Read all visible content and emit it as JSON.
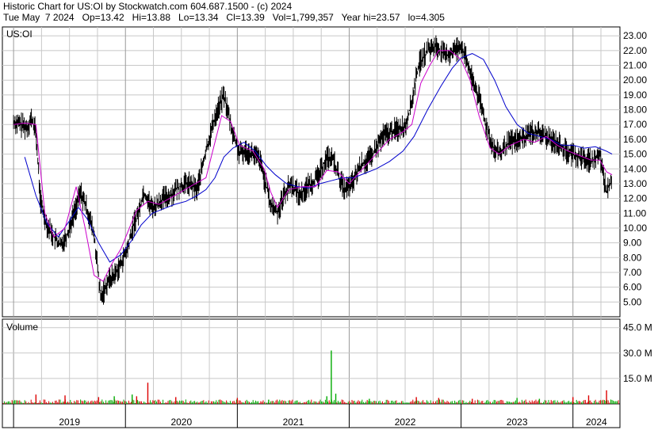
{
  "header": {
    "line1": "Historic Chart for US:OI by Stockwatch.com 604.687.1500 - (c) 2024",
    "line2": "Tue May  7 2024   Op=13.42   Hi=13.88   Lo=13.34   Cl=13.39   Vol=1,799,357   Year hi=23.57   lo=4.305"
  },
  "colors": {
    "price": "#000000",
    "ma_short": "#cc00cc",
    "ma_long": "#0000cc",
    "volume_up": "#00aa00",
    "volume_down": "#dd0000",
    "grid": "#c8c8c8"
  },
  "chart_data": {
    "type": "line",
    "symbol_label": "US:OI",
    "price_panel": {
      "ylim": [
        4.0,
        23.6
      ],
      "yticks": [
        5,
        6,
        7,
        8,
        9,
        10,
        11,
        12,
        13,
        14,
        15,
        16,
        17,
        18,
        19,
        20,
        21,
        22,
        23
      ],
      "ytick_labels": [
        "5.00",
        "6.00",
        "7.00",
        "8.00",
        "9.00",
        "10.00",
        "11.00",
        "12.00",
        "13.00",
        "14.00",
        "15.00",
        "16.00",
        "17.00",
        "18.00",
        "19.00",
        "20.00",
        "21.00",
        "22.00",
        "23.00"
      ],
      "close_series": {
        "t": [
          2019.0,
          2019.06,
          2019.12,
          2019.16,
          2019.2,
          2019.24,
          2019.3,
          2019.36,
          2019.42,
          2019.48,
          2019.54,
          2019.6,
          2019.66,
          2019.72,
          2019.78,
          2019.84,
          2019.9,
          2019.96,
          2020.02,
          2020.08,
          2020.12,
          2020.16,
          2020.2,
          2020.22,
          2020.26,
          2020.32,
          2020.4,
          2020.48,
          2020.56,
          2020.64,
          2020.72,
          2020.8,
          2020.88,
          2020.96,
          2021.02,
          2021.08,
          2021.14,
          2021.2,
          2021.26,
          2021.3,
          2021.36,
          2021.42,
          2021.48,
          2021.56,
          2021.64,
          2021.72,
          2021.8,
          2021.86,
          2021.92,
          2021.96,
          2022.02,
          2022.1,
          2022.2,
          2022.3,
          2022.4,
          2022.5,
          2022.56,
          2022.62,
          2022.7,
          2022.78,
          2022.86,
          2022.94,
          2023.0,
          2023.04,
          2023.1,
          2023.16,
          2023.22,
          2023.3,
          2023.36,
          2023.4,
          2023.44,
          2023.5,
          2023.56,
          2023.62,
          2023.7,
          2023.78,
          2023.86,
          2023.94,
          2024.0,
          2024.06,
          2024.12,
          2024.18,
          2024.24,
          2024.3,
          2024.35
        ],
        "close": [
          17.2,
          17.0,
          16.8,
          17.4,
          16.5,
          11.8,
          10.2,
          9.4,
          8.8,
          9.6,
          11.0,
          12.4,
          11.2,
          9.5,
          5.2,
          6.4,
          6.8,
          7.6,
          8.6,
          10.4,
          11.1,
          12.4,
          12.0,
          11.5,
          11.4,
          11.9,
          12.2,
          12.8,
          13.0,
          12.6,
          15.2,
          17.5,
          19.0,
          16.4,
          15.0,
          15.2,
          15.0,
          14.6,
          12.8,
          11.5,
          11.1,
          12.3,
          13.0,
          12.2,
          12.9,
          13.4,
          14.8,
          14.6,
          13.2,
          12.6,
          12.9,
          14.2,
          14.8,
          16.2,
          16.6,
          16.9,
          18.5,
          21.0,
          22.0,
          22.3,
          21.6,
          22.0,
          22.4,
          21.5,
          20.0,
          18.8,
          17.0,
          15.2,
          15.0,
          15.6,
          15.8,
          15.9,
          16.1,
          16.5,
          16.4,
          16.0,
          15.8,
          15.2,
          15.0,
          14.8,
          14.6,
          14.5,
          15.0,
          12.4,
          13.39
        ],
        "hi_lo_band": 1.5
      },
      "ma_short_series": {
        "t": [
          2019.0,
          2019.1,
          2019.2,
          2019.28,
          2019.36,
          2019.46,
          2019.56,
          2019.64,
          2019.72,
          2019.8,
          2019.88,
          2019.96,
          2020.1,
          2020.2,
          2020.3,
          2020.44,
          2020.6,
          2020.72,
          2020.8,
          2020.86,
          2020.94,
          2021.02,
          2021.14,
          2021.24,
          2021.3,
          2021.36,
          2021.46,
          2021.58,
          2021.7,
          2021.8,
          2021.9,
          2022.0,
          2022.12,
          2022.24,
          2022.36,
          2022.48,
          2022.56,
          2022.64,
          2022.72,
          2022.8,
          2022.9,
          2023.0,
          2023.08,
          2023.16,
          2023.26,
          2023.34,
          2023.44,
          2023.56,
          2023.66,
          2023.76,
          2023.86,
          2023.96,
          2024.06,
          2024.16,
          2024.24,
          2024.3,
          2024.35
        ],
        "v": [
          17.0,
          17.1,
          17.0,
          11.0,
          9.4,
          10.0,
          12.8,
          10.0,
          6.8,
          6.4,
          7.6,
          8.6,
          11.2,
          11.8,
          11.6,
          12.2,
          12.9,
          13.4,
          15.8,
          17.6,
          17.2,
          15.6,
          15.2,
          14.0,
          12.4,
          11.4,
          12.6,
          12.8,
          12.8,
          13.9,
          13.8,
          13.0,
          14.0,
          15.0,
          16.0,
          16.5,
          17.0,
          19.8,
          21.0,
          22.0,
          22.0,
          21.4,
          20.0,
          17.6,
          15.4,
          15.0,
          15.6,
          16.0,
          15.8,
          16.2,
          15.6,
          15.2,
          14.9,
          14.6,
          14.6,
          13.8,
          13.6
        ]
      },
      "ma_long_series": {
        "t": [
          2019.1,
          2019.2,
          2019.3,
          2019.4,
          2019.5,
          2019.58,
          2019.66,
          2019.76,
          2019.86,
          2019.96,
          2020.06,
          2020.14,
          2020.24,
          2020.34,
          2020.44,
          2020.54,
          2020.64,
          2020.72,
          2020.8,
          2020.88,
          2020.96,
          2021.06,
          2021.16,
          2021.26,
          2021.34,
          2021.44,
          2021.54,
          2021.64,
          2021.74,
          2021.84,
          2021.94,
          2022.04,
          2022.14,
          2022.24,
          2022.36,
          2022.48,
          2022.58,
          2022.7,
          2022.82,
          2022.92,
          2023.0,
          2023.1,
          2023.2,
          2023.3,
          2023.4,
          2023.5,
          2023.6,
          2023.7,
          2023.8,
          2023.9,
          2024.0,
          2024.1,
          2024.2,
          2024.3,
          2024.35
        ],
        "v": [
          14.8,
          12.2,
          10.3,
          9.4,
          10.5,
          11.4,
          10.6,
          9.0,
          7.7,
          8.2,
          9.2,
          10.2,
          11.0,
          11.3,
          11.6,
          11.8,
          12.2,
          12.6,
          13.4,
          14.8,
          15.4,
          15.8,
          15.2,
          14.2,
          13.6,
          13.0,
          12.8,
          12.7,
          13.0,
          13.2,
          13.4,
          13.4,
          13.7,
          14.0,
          14.5,
          15.2,
          16.2,
          18.0,
          19.6,
          20.8,
          21.5,
          21.8,
          21.4,
          20.0,
          18.2,
          17.0,
          16.4,
          16.2,
          16.0,
          15.6,
          15.6,
          15.4,
          15.5,
          15.2,
          15.0
        ]
      }
    },
    "volume_panel": {
      "title": "Volume",
      "ylim": [
        0,
        50
      ],
      "yticks": [
        15,
        30,
        45
      ],
      "ytick_labels": [
        "15.0 M",
        "30.0 M",
        "45.0 M"
      ],
      "spikes": [
        {
          "t": 2019.2,
          "v": 5.5,
          "dir": "down"
        },
        {
          "t": 2019.46,
          "v": 5.0,
          "dir": "down"
        },
        {
          "t": 2019.76,
          "v": 4.0,
          "dir": "down"
        },
        {
          "t": 2019.9,
          "v": 4.5,
          "dir": "up"
        },
        {
          "t": 2020.06,
          "v": 5.5,
          "dir": "up"
        },
        {
          "t": 2020.1,
          "v": 4.5,
          "dir": "down"
        },
        {
          "t": 2020.2,
          "v": 12.5,
          "dir": "down"
        },
        {
          "t": 2020.45,
          "v": 4.0,
          "dir": "down"
        },
        {
          "t": 2021.0,
          "v": 3.5,
          "dir": "down"
        },
        {
          "t": 2021.28,
          "v": 2.5,
          "dir": "up"
        },
        {
          "t": 2021.8,
          "v": 4.5,
          "dir": "up"
        },
        {
          "t": 2021.84,
          "v": 31.5,
          "dir": "up"
        },
        {
          "t": 2021.88,
          "v": 6.0,
          "dir": "up"
        },
        {
          "t": 2022.18,
          "v": 3.0,
          "dir": "up"
        },
        {
          "t": 2022.6,
          "v": 4.0,
          "dir": "down"
        },
        {
          "t": 2022.8,
          "v": 3.5,
          "dir": "down"
        },
        {
          "t": 2023.1,
          "v": 3.0,
          "dir": "down"
        },
        {
          "t": 2023.5,
          "v": 3.5,
          "dir": "up"
        },
        {
          "t": 2023.7,
          "v": 3.0,
          "dir": "up"
        },
        {
          "t": 2024.0,
          "v": 4.0,
          "dir": "down"
        },
        {
          "t": 2024.14,
          "v": 5.0,
          "dir": "down"
        },
        {
          "t": 2024.3,
          "v": 8.0,
          "dir": "down"
        }
      ],
      "baseline_max": 2.2
    },
    "x_axis": {
      "range": [
        2018.9,
        2024.42
      ],
      "year_ticks": [
        2019,
        2020,
        2021,
        2022,
        2023,
        2024
      ],
      "label_ticks": [
        2019,
        2020,
        2021,
        2022,
        2023,
        2024
      ],
      "labels": [
        "2019",
        "2020",
        "2021",
        "2022",
        "2023",
        "2024"
      ],
      "grid_ticks": [
        2019.25,
        2019.5,
        2019.75,
        2020.25,
        2020.5,
        2020.75,
        2021.25,
        2021.5,
        2021.75,
        2022.25,
        2022.5,
        2022.75,
        2023.25,
        2023.5,
        2023.75,
        2024.25
      ]
    }
  }
}
